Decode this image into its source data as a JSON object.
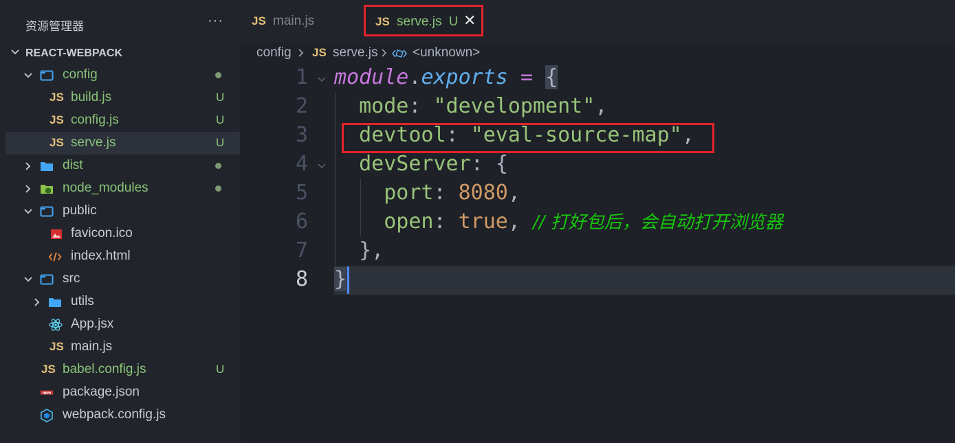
{
  "sidebar": {
    "title": "资源管理器",
    "more": "···",
    "project": "REACT-WEBPACK",
    "items": [
      {
        "label": "config",
        "kind": "folder-open",
        "badge": "",
        "dot": true
      },
      {
        "label": "build.js",
        "kind": "js",
        "badge": "U",
        "dot": false
      },
      {
        "label": "config.js",
        "kind": "js",
        "badge": "U",
        "dot": false
      },
      {
        "label": "serve.js",
        "kind": "js",
        "badge": "U",
        "dot": false
      },
      {
        "label": "dist",
        "kind": "folder-closed",
        "badge": "",
        "dot": true
      },
      {
        "label": "node_modules",
        "kind": "node-folder",
        "badge": "",
        "dot": true
      },
      {
        "label": "public",
        "kind": "folder-open",
        "badge": "",
        "dot": false
      },
      {
        "label": "favicon.ico",
        "kind": "image",
        "badge": "",
        "dot": false
      },
      {
        "label": "index.html",
        "kind": "html",
        "badge": "",
        "dot": false
      },
      {
        "label": "src",
        "kind": "folder-open",
        "badge": "",
        "dot": false
      },
      {
        "label": "utils",
        "kind": "folder-closed",
        "badge": "",
        "dot": false
      },
      {
        "label": "App.jsx",
        "kind": "react",
        "badge": "",
        "dot": false
      },
      {
        "label": "main.js",
        "kind": "js",
        "badge": "",
        "dot": false
      },
      {
        "label": "babel.config.js",
        "kind": "js",
        "badge": "U",
        "dot": false
      },
      {
        "label": "package.json",
        "kind": "npm",
        "badge": "",
        "dot": false
      },
      {
        "label": "webpack.config.js",
        "kind": "webpack",
        "badge": "",
        "dot": false
      }
    ]
  },
  "tabs": [
    {
      "js": "JS",
      "label": "main.js"
    },
    {
      "js": "JS",
      "label": "serve.js",
      "badge": "U",
      "close": "✕"
    }
  ],
  "breadcrumb": {
    "folder": "config",
    "js": "JS",
    "file": "serve.js",
    "symbol": "<unknown>"
  },
  "editor": {
    "line_numbers": [
      "1",
      "2",
      "3",
      "4",
      "5",
      "6",
      "7",
      "8"
    ],
    "line1": {
      "kw": "module",
      "dot": ".",
      "prop": "exports",
      "eq": "=",
      "brace": "{"
    },
    "line2": {
      "key": "mode",
      "colon": ":",
      "value": "\"development\"",
      "comma": ","
    },
    "line3": {
      "key": "devtool",
      "colon": ":",
      "value": "\"eval-source-map\"",
      "comma": ","
    },
    "line4": {
      "key": "devServer",
      "colon": ":",
      "brace": "{"
    },
    "line5": {
      "key": "port",
      "colon": ":",
      "value": "8080",
      "comma": ","
    },
    "line6": {
      "key": "open",
      "colon": ":",
      "value": "true",
      "comma": ",",
      "comment": "// 打好包后，会自动打开浏览器"
    },
    "line7": {
      "text": "},"
    },
    "line8": {
      "text": "}"
    }
  },
  "colors": {
    "highlight_box": "#e3232a",
    "modified_green": "#8ac379",
    "js_yellow": "#e5c07b",
    "comment_green": "#16c60c"
  }
}
